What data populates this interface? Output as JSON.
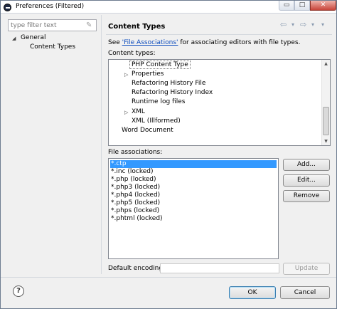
{
  "window": {
    "title": "Preferences (Filtered)",
    "controls": {
      "minimize": "▭",
      "maximize": "□",
      "close": "✕"
    }
  },
  "filter": {
    "placeholder": "type filter text"
  },
  "nav_tree": {
    "items": [
      {
        "label": "General",
        "expanded": true
      },
      {
        "label": "Content Types",
        "selected": true
      }
    ]
  },
  "page": {
    "title": "Content Types",
    "see_prefix": "See ",
    "see_link": "'File Associations'",
    "see_suffix": " for associating editors with file types.",
    "content_types_label": "Content types:",
    "file_associations_label": "File associations:",
    "default_encoding_label": "Default encoding:"
  },
  "content_types": [
    {
      "label": "PHP Content Type",
      "selected": true
    },
    {
      "label": "Properties",
      "expandable": true
    },
    {
      "label": "Refactoring History File"
    },
    {
      "label": "Refactoring History Index"
    },
    {
      "label": "Runtime log files"
    },
    {
      "label": "XML",
      "expandable": true
    },
    {
      "label": "XML (Illformed)"
    },
    {
      "label": "Word Document"
    }
  ],
  "file_associations": [
    {
      "label": "*.ctp",
      "selected": true
    },
    {
      "label": "*.inc (locked)"
    },
    {
      "label": "*.php (locked)"
    },
    {
      "label": "*.php3 (locked)"
    },
    {
      "label": "*.php4 (locked)"
    },
    {
      "label": "*.php5 (locked)"
    },
    {
      "label": "*.phps (locked)"
    },
    {
      "label": "*.phtml (locked)"
    }
  ],
  "buttons": {
    "add": "Add...",
    "edit": "Edit...",
    "remove": "Remove",
    "update": "Update",
    "ok": "OK",
    "cancel": "Cancel"
  },
  "default_encoding": {
    "value": ""
  },
  "icons": {
    "back": "⇦",
    "forward": "⇨",
    "dropdown": "▾",
    "expand": "▷",
    "collapse": "◢",
    "help": "?",
    "clear": "✎"
  },
  "colors": {
    "selection": "#3399ff",
    "link": "#0b4bbd"
  }
}
